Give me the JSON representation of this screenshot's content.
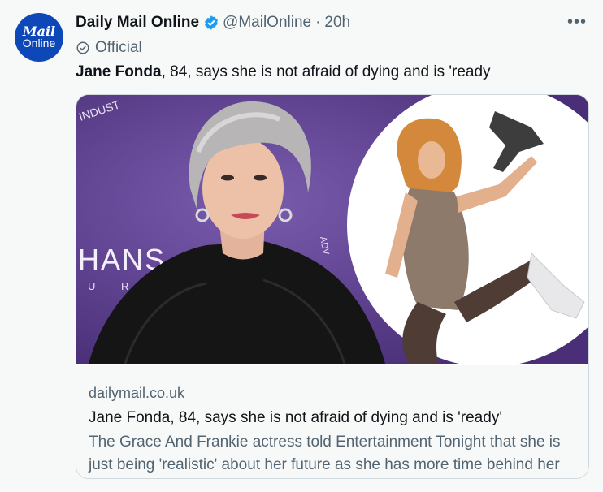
{
  "account": {
    "avatar_line1": "Mail",
    "avatar_line2": "Online",
    "name": "Daily Mail Online",
    "handle": "@MailOnline",
    "separator": "·",
    "time": "20h",
    "label": "Official"
  },
  "menu_icon": "more-horizontal-icon",
  "tweet": {
    "text_bold": "Jane Fonda",
    "text_rest": ", 84, says she is not afraid of dying and is 'ready"
  },
  "media": {
    "backdrop_top": "INDUST",
    "backdrop_logo": "HANS",
    "backdrop_sub": "U R E",
    "backdrop_side": "ADV"
  },
  "card": {
    "domain": "dailymail.co.uk",
    "title": "Jane Fonda, 84, says she is not afraid of dying and is 'ready'",
    "description": "The Grace And Frankie actress told Entertainment Tonight that she is just being 'realistic' about her future as she has more time behind her ..."
  },
  "colors": {
    "verified_blue": "#1d9bf0",
    "avatar_blue": "#0d47b8",
    "backdrop_purple": "#5b3f8c"
  }
}
